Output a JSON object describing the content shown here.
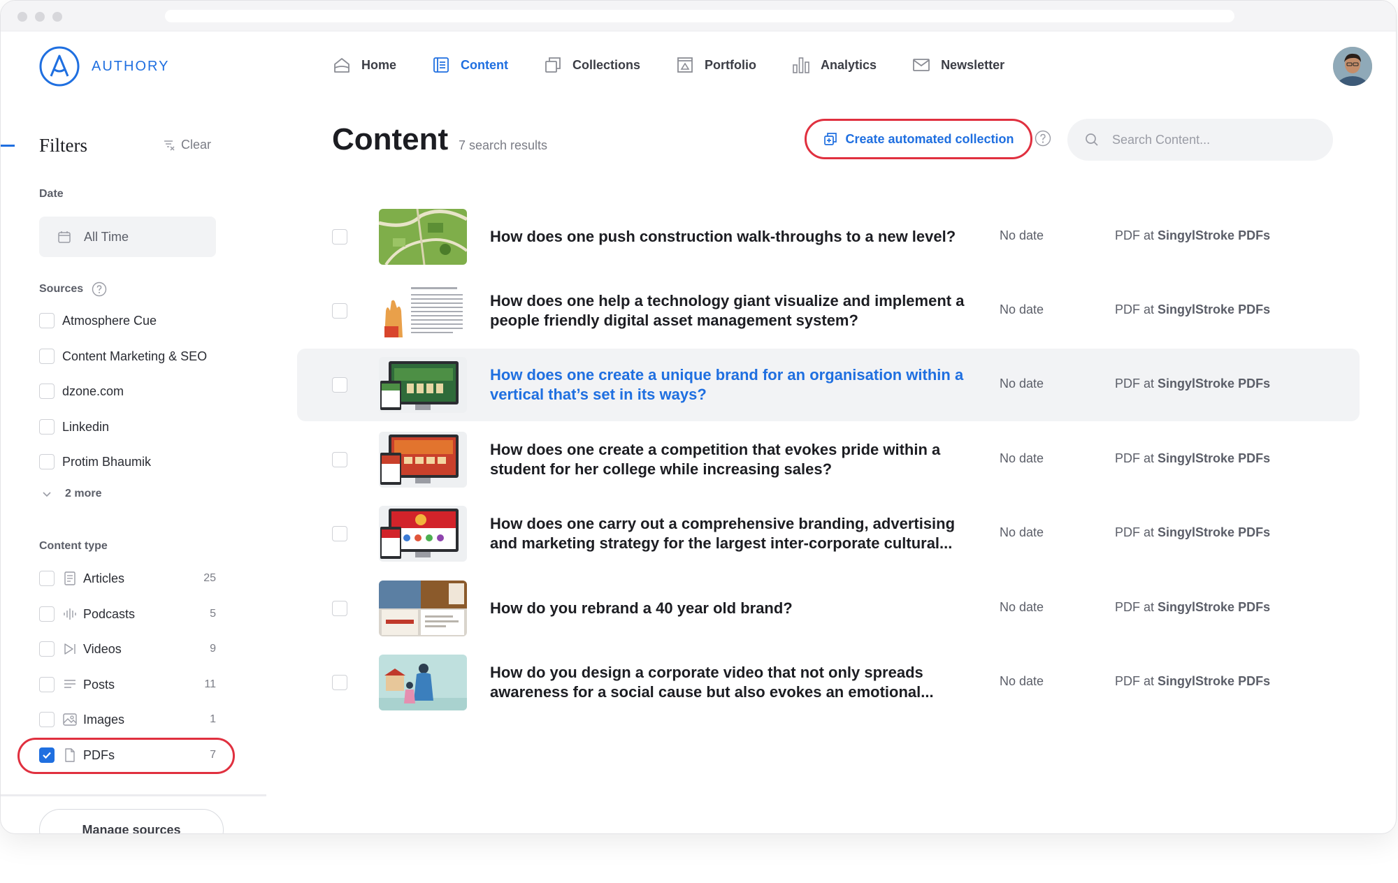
{
  "app": {
    "brand": "AUTHORY",
    "accent": "#1f6fe0",
    "highlight": "#e0303f"
  },
  "nav": {
    "items": [
      {
        "label": "Home",
        "icon": "home-icon"
      },
      {
        "label": "Content",
        "icon": "content-icon",
        "active": true
      },
      {
        "label": "Collections",
        "icon": "collections-icon"
      },
      {
        "label": "Portfolio",
        "icon": "portfolio-icon"
      },
      {
        "label": "Analytics",
        "icon": "analytics-icon"
      },
      {
        "label": "Newsletter",
        "icon": "newsletter-icon"
      }
    ]
  },
  "sidebar": {
    "title": "Filters",
    "clear": "Clear",
    "date_label": "Date",
    "date_value": "All Time",
    "sources_label": "Sources",
    "sources": [
      "Atmosphere Cue",
      "Content Marketing & SEO",
      "dzone.com",
      "Linkedin",
      "Protim Bhaumik"
    ],
    "more": "2 more",
    "content_type_label": "Content type",
    "content_types": [
      {
        "label": "Articles",
        "count": "25",
        "icon": "article-icon",
        "checked": false
      },
      {
        "label": "Podcasts",
        "count": "5",
        "icon": "podcast-icon",
        "checked": false
      },
      {
        "label": "Videos",
        "count": "9",
        "icon": "video-icon",
        "checked": false
      },
      {
        "label": "Posts",
        "count": "11",
        "icon": "post-icon",
        "checked": false
      },
      {
        "label": "Images",
        "count": "1",
        "icon": "image-icon",
        "checked": false
      },
      {
        "label": "PDFs",
        "count": "7",
        "icon": "pdf-icon",
        "checked": true
      }
    ],
    "manage_sources": "Manage sources"
  },
  "main": {
    "title": "Content",
    "results": "7 search results",
    "create_collection": "Create automated collection",
    "search_placeholder": "Search Content...",
    "items": [
      {
        "title": "How does one push construction walk-throughs to a new level?",
        "date": "No date",
        "src_prefix": "PDF at",
        "src_name": "SingylStroke PDFs",
        "thumb": "map"
      },
      {
        "title": "How does one help a technology giant visualize and implement a people friendly digital asset management system?",
        "date": "No date",
        "src_prefix": "PDF at",
        "src_name": "SingylStroke PDFs",
        "thumb": "doc"
      },
      {
        "title": "How does one create a unique brand for an organisation within a vertical that’s set in its ways?",
        "date": "No date",
        "src_prefix": "PDF at",
        "src_name": "SingylStroke PDFs",
        "thumb": "green-site"
      },
      {
        "title": "How does one create a competition that evokes pride within a student for her college while increasing sales?",
        "date": "No date",
        "src_prefix": "PDF at",
        "src_name": "SingylStroke PDFs",
        "thumb": "orange-site"
      },
      {
        "title": "How does one carry out a comprehensive branding, advertising and marketing strategy for the largest inter-corporate cultural...",
        "date": "No date",
        "src_prefix": "PDF at",
        "src_name": "SingylStroke PDFs",
        "thumb": "red-site"
      },
      {
        "title": "How do you rebrand a 40 year old brand?",
        "date": "No date",
        "src_prefix": "PDF at",
        "src_name": "SingylStroke PDFs",
        "thumb": "collage"
      },
      {
        "title": "How do you design a corporate video that not only spreads awareness for a social cause but also evokes an emotional...",
        "date": "No date",
        "src_prefix": "PDF at",
        "src_name": "SingylStroke PDFs",
        "thumb": "illustration"
      }
    ]
  }
}
